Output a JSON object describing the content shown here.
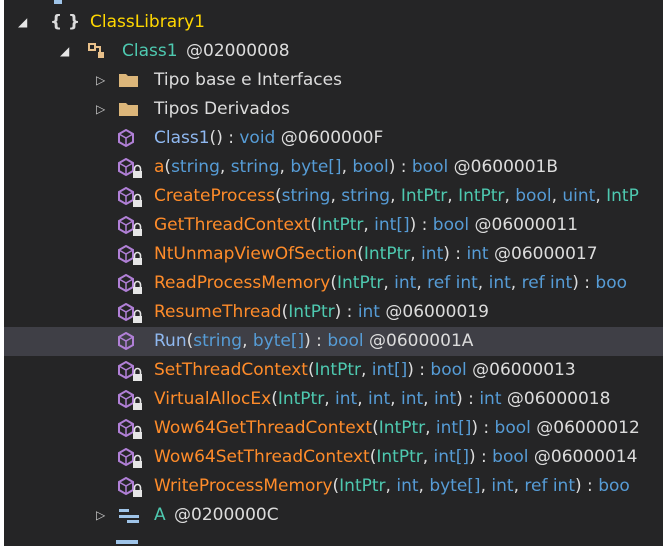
{
  "tree": {
    "namespace": {
      "braces": "{ }",
      "label": "ClassLibrary1"
    },
    "class": {
      "name": "Class1",
      "addr": "@02000008"
    },
    "folders": [
      {
        "label": "Tipo base e Interfaces"
      },
      {
        "label": "Tipos Derivados"
      }
    ],
    "methods": [
      {
        "access": "public",
        "name": "Class1",
        "params": [],
        "ret": "void",
        "addr": "@0600000F"
      },
      {
        "access": "private",
        "name": "a",
        "params": [
          {
            "t": "string",
            "k": "kw"
          },
          {
            "t": "string",
            "k": "kw"
          },
          {
            "t": "byte[]",
            "k": "kw"
          },
          {
            "t": "bool",
            "k": "kw"
          }
        ],
        "ret": "bool",
        "addr": "@0600001B"
      },
      {
        "access": "private",
        "name": "CreateProcess",
        "params": [
          {
            "t": "string",
            "k": "kw"
          },
          {
            "t": "string",
            "k": "kw"
          },
          {
            "t": "IntPtr",
            "k": "ty"
          },
          {
            "t": "IntPtr",
            "k": "ty"
          },
          {
            "t": "bool",
            "k": "kw"
          },
          {
            "t": "uint",
            "k": "kw"
          },
          {
            "t": "IntP",
            "k": "ty"
          }
        ],
        "truncated": true,
        "ret": "",
        "addr": ""
      },
      {
        "access": "private",
        "name": "GetThreadContext",
        "params": [
          {
            "t": "IntPtr",
            "k": "ty"
          },
          {
            "t": "int[]",
            "k": "kw"
          }
        ],
        "ret": "bool",
        "addr": "@06000011"
      },
      {
        "access": "private",
        "name": "NtUnmapViewOfSection",
        "params": [
          {
            "t": "IntPtr",
            "k": "ty"
          },
          {
            "t": "int",
            "k": "kw"
          }
        ],
        "ret": "int",
        "addr": "@06000017"
      },
      {
        "access": "private",
        "name": "ReadProcessMemory",
        "params": [
          {
            "t": "IntPtr",
            "k": "ty"
          },
          {
            "t": "int",
            "k": "kw"
          },
          {
            "t": "ref int",
            "k": "kw"
          },
          {
            "t": "int",
            "k": "kw"
          },
          {
            "t": "ref int",
            "k": "kw"
          }
        ],
        "ret": "boo",
        "retTrunc": true,
        "addr": ""
      },
      {
        "access": "private",
        "name": "ResumeThread",
        "params": [
          {
            "t": "IntPtr",
            "k": "ty"
          }
        ],
        "ret": "int",
        "addr": "@06000019"
      },
      {
        "access": "public",
        "name": "Run",
        "params": [
          {
            "t": "string",
            "k": "kw"
          },
          {
            "t": "byte[]",
            "k": "kw"
          }
        ],
        "ret": "bool",
        "addr": "@0600001A",
        "selected": true
      },
      {
        "access": "private",
        "name": "SetThreadContext",
        "params": [
          {
            "t": "IntPtr",
            "k": "ty"
          },
          {
            "t": "int[]",
            "k": "kw"
          }
        ],
        "ret": "bool",
        "addr": "@06000013"
      },
      {
        "access": "private",
        "name": "VirtualAllocEx",
        "params": [
          {
            "t": "IntPtr",
            "k": "ty"
          },
          {
            "t": "int",
            "k": "kw"
          },
          {
            "t": "int",
            "k": "kw"
          },
          {
            "t": "int",
            "k": "kw"
          },
          {
            "t": "int",
            "k": "kw"
          }
        ],
        "ret": "int",
        "addr": "@06000018"
      },
      {
        "access": "private",
        "name": "Wow64GetThreadContext",
        "params": [
          {
            "t": "IntPtr",
            "k": "ty"
          },
          {
            "t": "int[]",
            "k": "kw"
          }
        ],
        "ret": "bool",
        "addr": "@06000012"
      },
      {
        "access": "private",
        "name": "Wow64SetThreadContext",
        "params": [
          {
            "t": "IntPtr",
            "k": "ty"
          },
          {
            "t": "int[]",
            "k": "kw"
          }
        ],
        "ret": "bool",
        "addr": "@06000014"
      },
      {
        "access": "private",
        "name": "WriteProcessMemory",
        "params": [
          {
            "t": "IntPtr",
            "k": "ty"
          },
          {
            "t": "int",
            "k": "kw"
          },
          {
            "t": "byte[]",
            "k": "kw"
          },
          {
            "t": "int",
            "k": "kw"
          },
          {
            "t": "ref int",
            "k": "kw"
          }
        ],
        "ret": "boo",
        "retTrunc": true,
        "addr": ""
      }
    ],
    "nested": {
      "name": "A",
      "addr": "@0200000C"
    }
  },
  "colors": {
    "background": "#252526",
    "selection": "#3f3f46",
    "namespace": "#ffd700",
    "type": "#4ec9b0",
    "keyword": "#569cd6",
    "private_method": "#ff8c2a",
    "public_method": "#8fb8f0",
    "icon_purple": "#b180d7"
  }
}
